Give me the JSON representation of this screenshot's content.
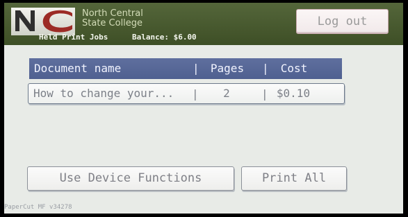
{
  "college": {
    "logo_letters": "NC",
    "name_line1": "North Central",
    "name_line2": "State College"
  },
  "status": {
    "section": "Held Print Jobs",
    "balance": "Balance: $6.00"
  },
  "header": {
    "logout_label": "Log out"
  },
  "jobs_table": {
    "columns": [
      "Document name",
      "Pages",
      "Cost"
    ],
    "separator": "|",
    "rows": [
      {
        "document": "How to change your...",
        "pages": "2",
        "cost": "$0.10"
      }
    ]
  },
  "actions": {
    "use_device_label": "Use Device Functions",
    "print_all_label": "Print All"
  },
  "footer": {
    "version": "PaperCut MF v34278"
  },
  "colors": {
    "header_green": "#4a5c30",
    "table_header_blue": "#56679a",
    "logo_red": "#9c2b26"
  }
}
